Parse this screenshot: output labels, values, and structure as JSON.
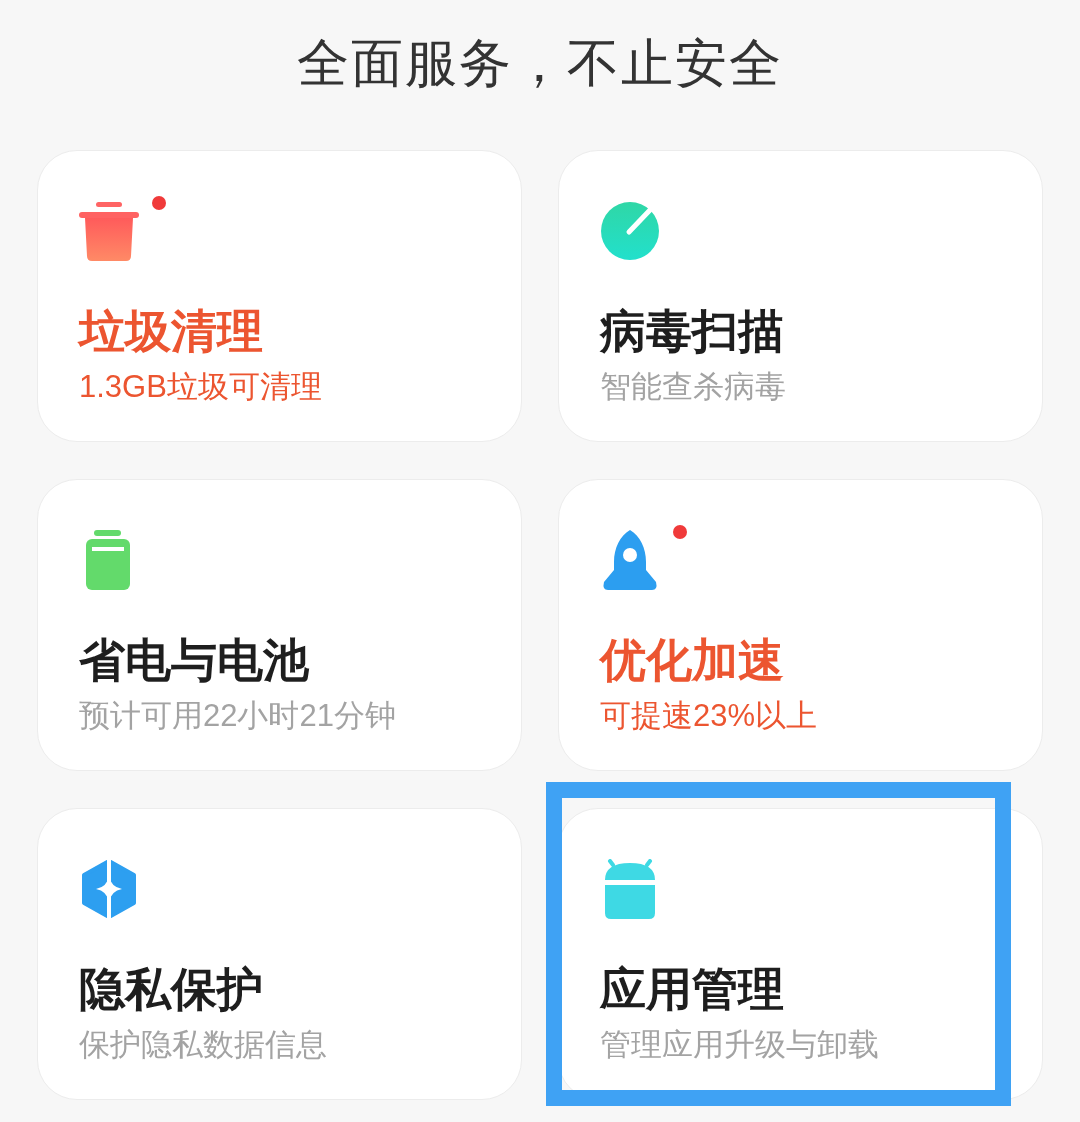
{
  "title": "全面服务，不止安全",
  "cards": [
    {
      "kind": "trash",
      "title": "垃圾清理",
      "subtitle": "1.3GB垃圾可清理",
      "alert": true,
      "highlighted": false
    },
    {
      "kind": "gauge",
      "title": "病毒扫描",
      "subtitle": "智能查杀病毒",
      "alert": false,
      "highlighted": false
    },
    {
      "kind": "battery",
      "title": "省电与电池",
      "subtitle": "预计可用22小时21分钟",
      "alert": false,
      "highlighted": false
    },
    {
      "kind": "rocket",
      "title": "优化加速",
      "subtitle": "可提速23%以上",
      "alert": true,
      "highlighted": false
    },
    {
      "kind": "shield",
      "title": "隐私保护",
      "subtitle": "保护隐私数据信息",
      "alert": false,
      "highlighted": false
    },
    {
      "kind": "android",
      "title": "应用管理",
      "subtitle": "管理应用升级与卸载",
      "alert": false,
      "highlighted": true
    }
  ]
}
